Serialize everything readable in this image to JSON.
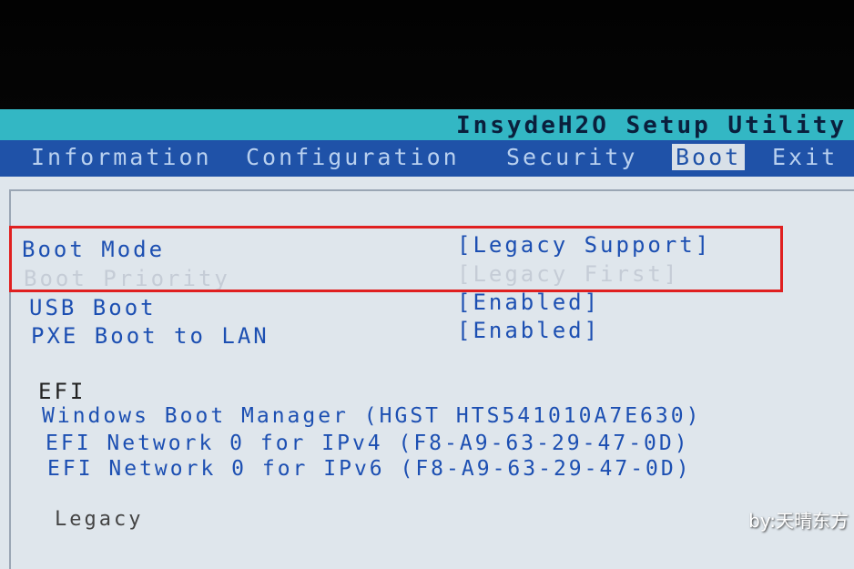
{
  "header": {
    "title": "InsydeH2O Setup Utility"
  },
  "menu": {
    "tabs": [
      {
        "label": "Information"
      },
      {
        "label": "Configuration"
      },
      {
        "label": "Security"
      },
      {
        "label": "Boot"
      },
      {
        "label": "Exit"
      }
    ],
    "selected": "Boot"
  },
  "boot_settings": [
    {
      "label": "Boot Mode",
      "value": "[Legacy Support]"
    },
    {
      "label": "Boot Priority",
      "value": "[Legacy First]"
    },
    {
      "label": "USB Boot",
      "value": "[Enabled]"
    },
    {
      "label": "PXE Boot to LAN",
      "value": "[Enabled]"
    }
  ],
  "efi_section": {
    "heading": "EFI",
    "entries": [
      "Windows Boot Manager (HGST HTS541010A7E630)",
      "EFI Network 0 for IPv4 (F8-A9-63-29-47-0D)",
      "EFI Network 0 for IPv6 (F8-A9-63-29-47-0D)"
    ]
  },
  "legacy_section": {
    "heading": "Legacy"
  },
  "watermark": "by:天晴东方",
  "colors": {
    "title_bar": "#33b7c4",
    "menu_bar": "#1f52a8",
    "panel_bg": "#dfe6ec",
    "item_text": "#1c4fb2",
    "highlight_outline": "#e02020"
  }
}
